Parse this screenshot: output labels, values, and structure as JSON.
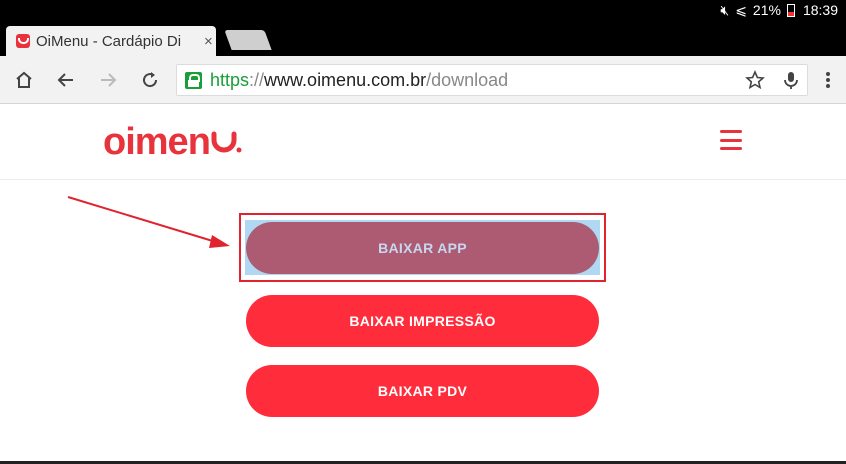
{
  "status_bar": {
    "battery": "21%",
    "time": "18:39"
  },
  "tab": {
    "title": "OiMenu - Cardápio Di",
    "close": "×"
  },
  "toolbar": {
    "url_https": "https",
    "url_slashes": "://",
    "url_host": "www.oimenu.com.br",
    "url_path": "/download"
  },
  "header": {
    "logo": "oimen"
  },
  "buttons": {
    "app": "BAIXAR APP",
    "impressao": "BAIXAR IMPRESSÃO",
    "pdv": "BAIXAR PDV"
  },
  "colors": {
    "brand_red": "#ff2d3b",
    "highlight_box": "#e0242f",
    "selected_button": "#ad5b72",
    "secure_green": "#1a9e3a"
  },
  "icons": {
    "status": [
      "mute-icon",
      "wifi-icon",
      "battery-icon"
    ],
    "toolbar": [
      "home-icon",
      "back-icon",
      "forward-icon",
      "reload-icon",
      "lock-icon",
      "star-icon",
      "mic-icon",
      "menu-dots-icon"
    ],
    "page": [
      "hamburger-menu-icon",
      "annotation-arrow"
    ]
  }
}
